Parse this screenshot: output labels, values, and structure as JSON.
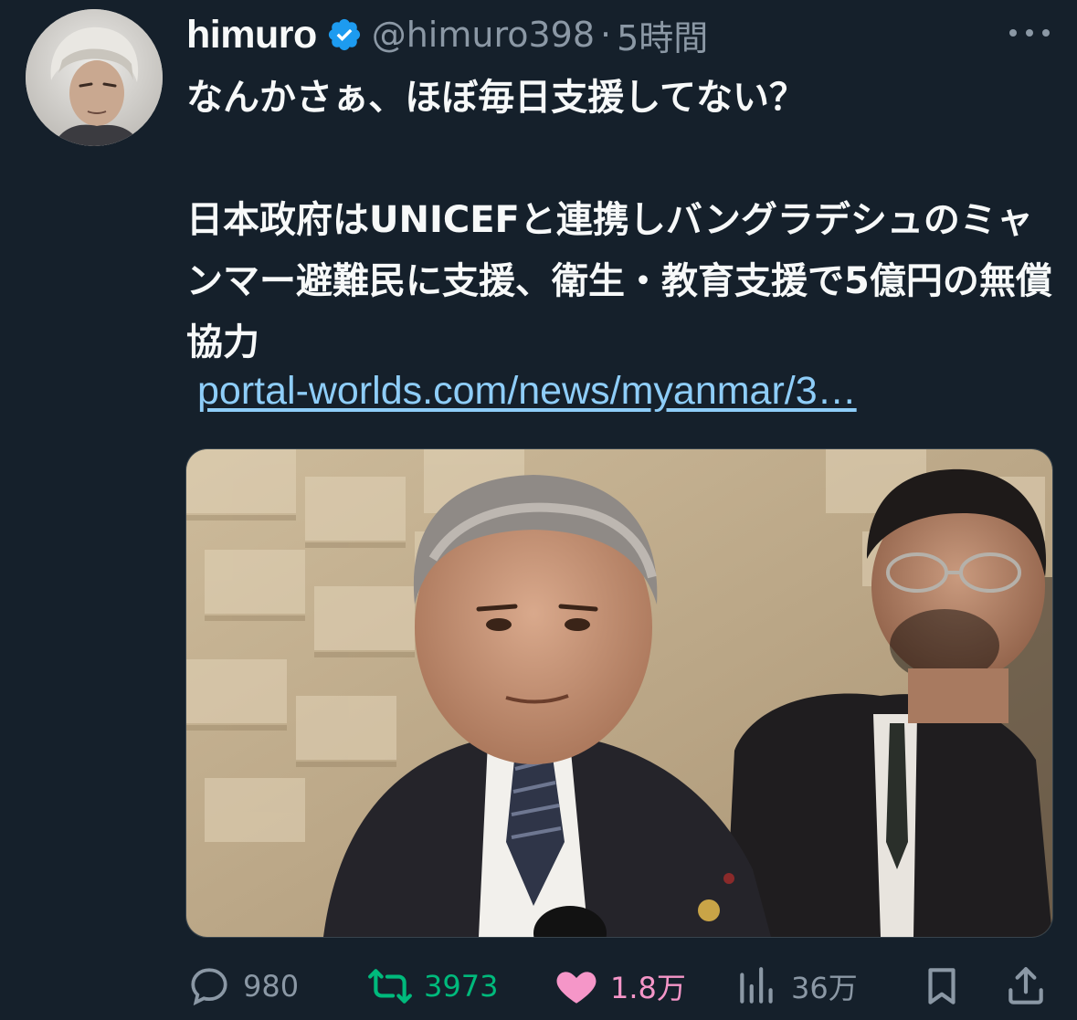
{
  "author": {
    "display_name": "himuro",
    "handle": "@himuro398",
    "separator": "·",
    "time": "5時間"
  },
  "tweet": {
    "text": "なんかさぁ、ほぼ毎日支援してない？\n\n日本政府はUNICEFと連携しバングラデシュのミャンマー避難民に支援、衛生・教育支援で5億円の無償協力",
    "link": "portal-worlds.com/news/myanmar/3…"
  },
  "actions": {
    "replies": "980",
    "retweets": "3973",
    "likes": "1.8万",
    "views": "36万"
  },
  "icons": {
    "verified": "verified-badge-icon",
    "more": "more-icon",
    "reply": "reply-icon",
    "retweet": "retweet-icon",
    "like": "heart-icon",
    "views": "views-icon",
    "bookmark": "bookmark-icon",
    "share": "share-icon"
  },
  "colors": {
    "background": "#15202b",
    "text_primary": "#f7f9f9",
    "text_secondary": "#8b98a5",
    "link": "#8ecdf8",
    "verified": "#1d9bf0",
    "retweet_active": "#00ba7c",
    "like_active": "#f91880"
  }
}
